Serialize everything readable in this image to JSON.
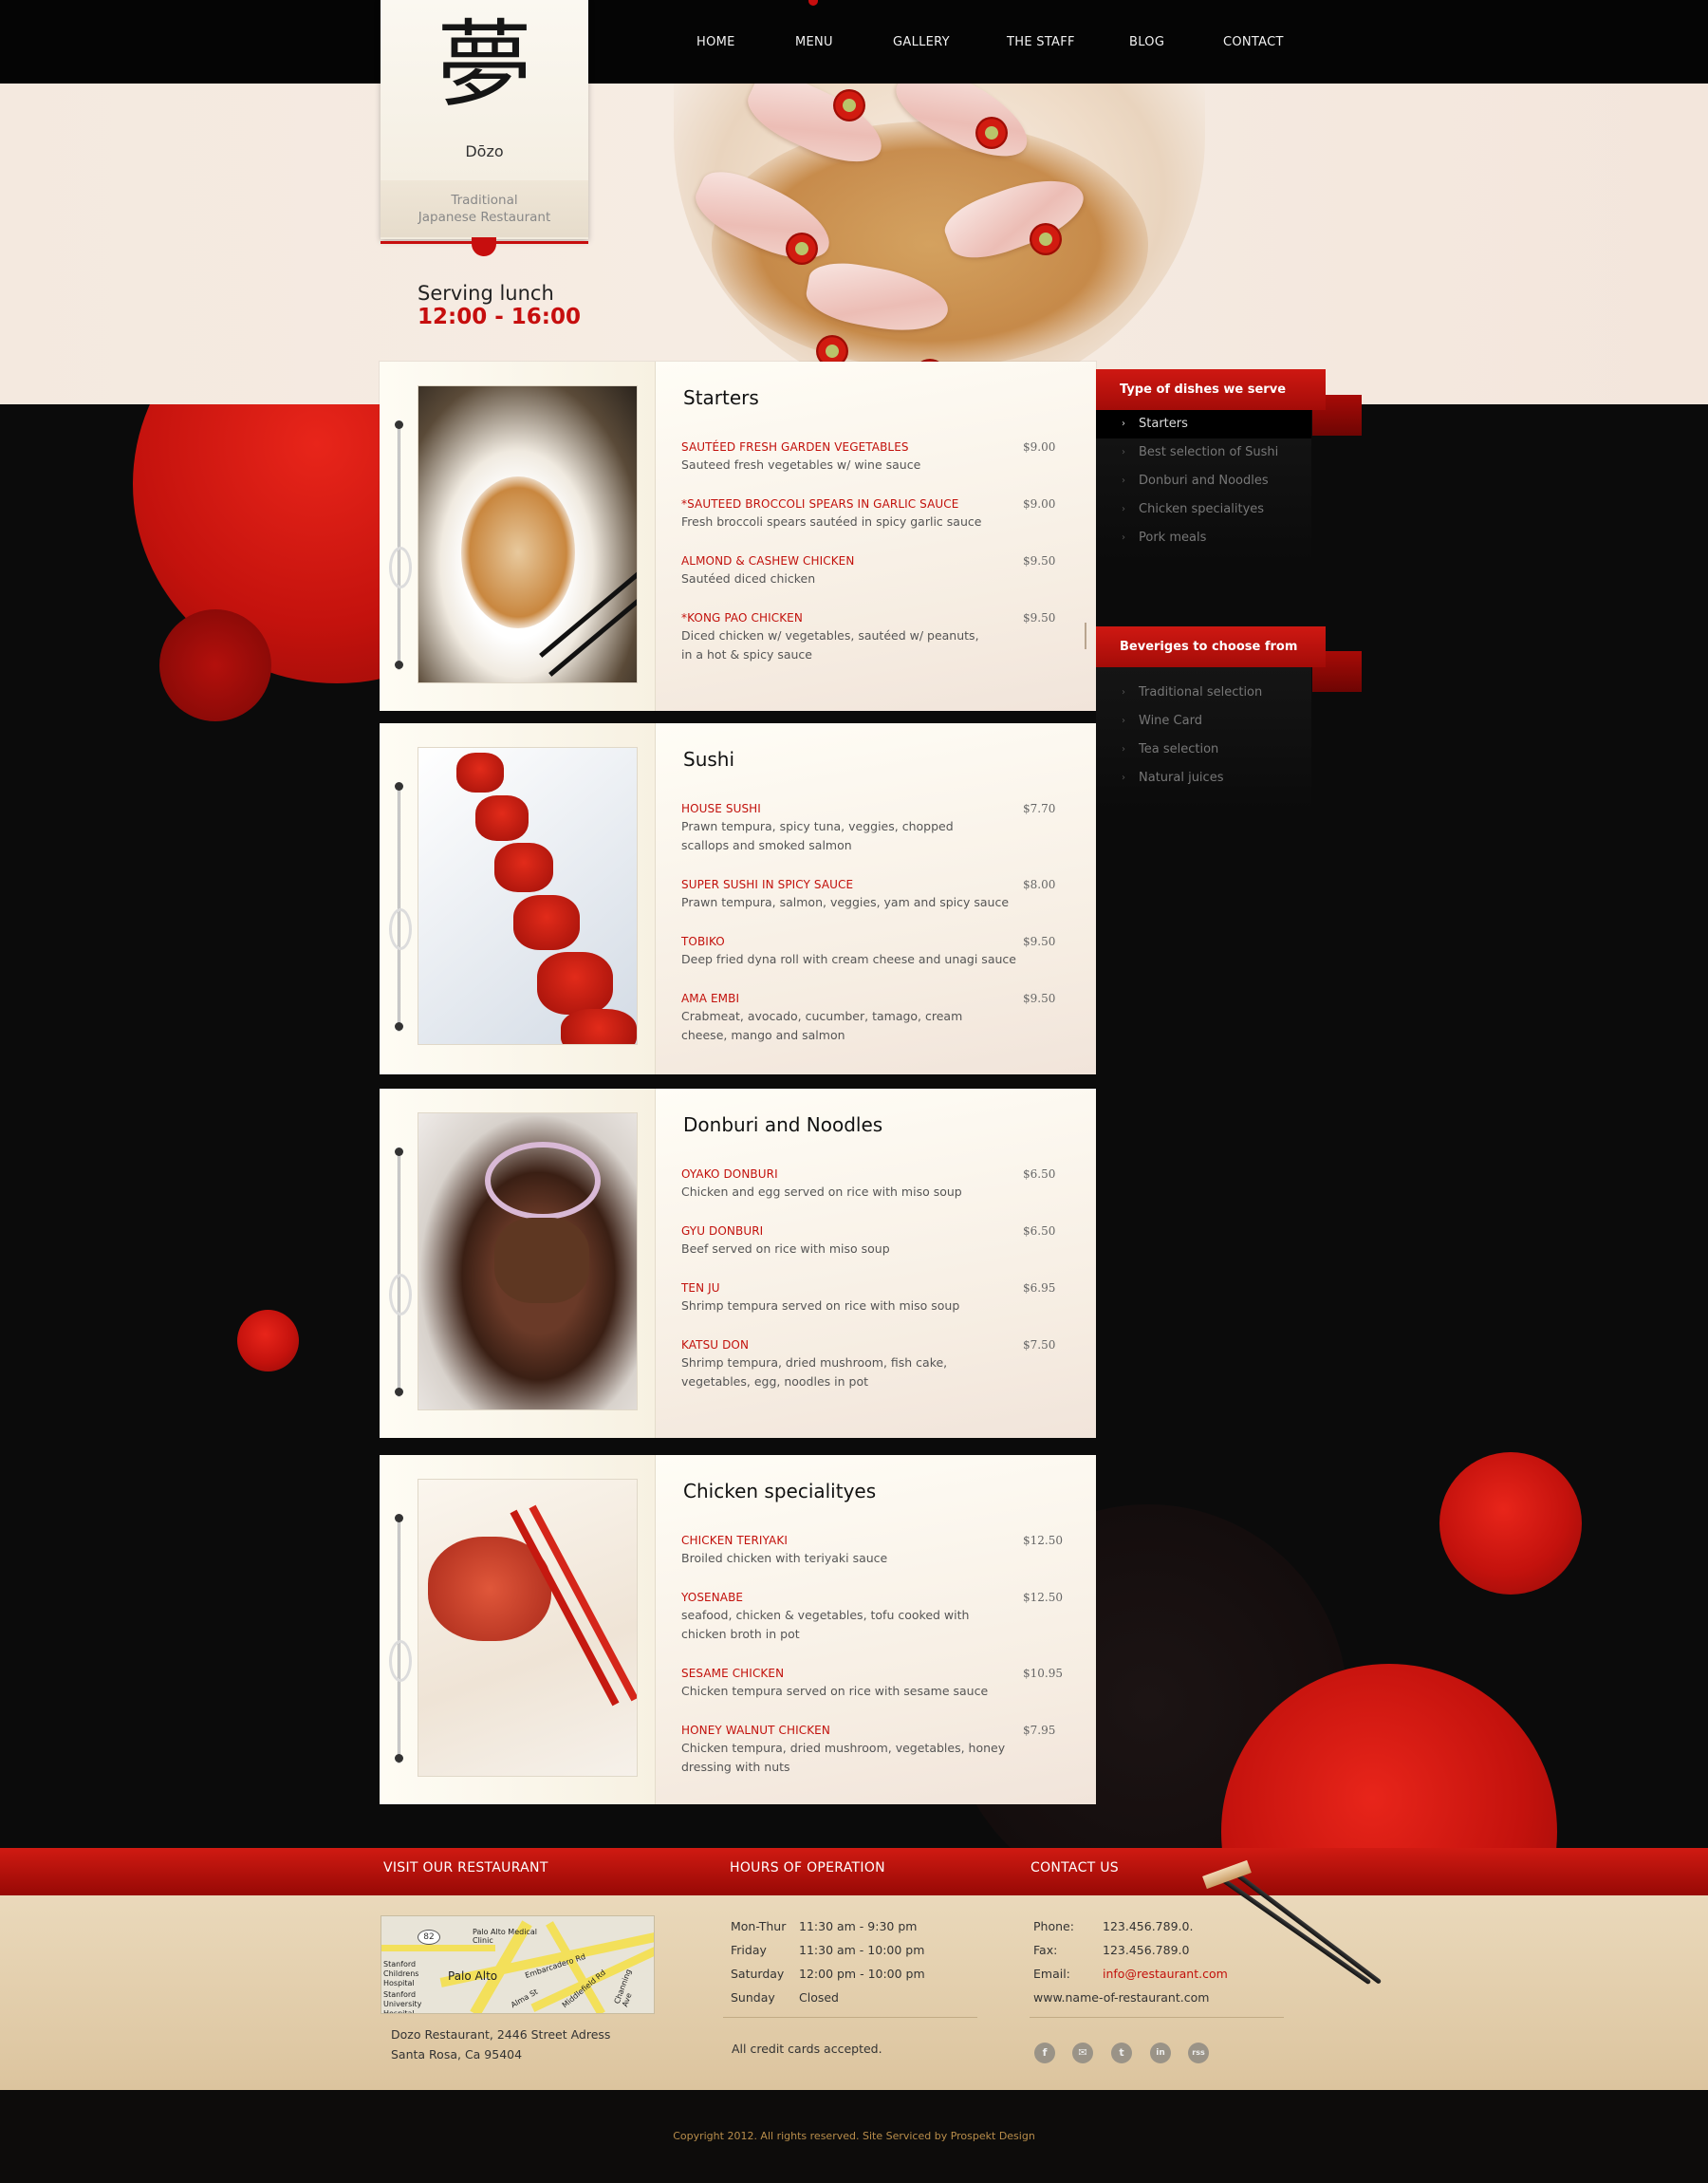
{
  "nav": {
    "items": [
      "HOME",
      "MENU",
      "GALLERY",
      "THE STAFF",
      "BLOG",
      "CONTACT"
    ]
  },
  "logo": {
    "kanji": "夢",
    "name": "Dōzo",
    "tagline_1": "Traditional",
    "tagline_2": "Japanese Restaurant"
  },
  "hours_banner": {
    "label": "Serving lunch",
    "time": "12:00 - 16:00"
  },
  "menu": [
    {
      "title": "Starters",
      "items": [
        {
          "name": "SAUTÉED FRESH GARDEN VEGETABLES",
          "desc": "Sauteed fresh vegetables w/ wine sauce",
          "price": "$9.00"
        },
        {
          "name": "*SAUTEED BROCCOLI SPEARS IN GARLIC SAUCE",
          "desc": "Fresh broccoli spears sautéed in spicy garlic sauce",
          "price": "$9.00"
        },
        {
          "name": "ALMOND & CASHEW CHICKEN",
          "desc": "Sautéed diced chicken",
          "price": "$9.50"
        },
        {
          "name": "*KONG PAO CHICKEN",
          "desc": "Diced chicken w/ vegetables, sautéed w/ peanuts, in a hot & spicy sauce",
          "price": "$9.50"
        }
      ]
    },
    {
      "title": "Sushi",
      "items": [
        {
          "name": "HOUSE SUSHI",
          "desc": "Prawn tempura, spicy tuna, veggies, chopped scallops and smoked salmon",
          "price": "$7.70"
        },
        {
          "name": "SUPER SUSHI  IN SPICY SAUCE",
          "desc": "Prawn tempura, salmon, veggies, yam and spicy sauce",
          "price": "$8.00"
        },
        {
          "name": "TOBIKO",
          "desc": "Deep fried dyna roll with cream cheese and unagi sauce",
          "price": "$9.50"
        },
        {
          "name": "AMA EMBI",
          "desc": "Crabmeat, avocado, cucumber, tamago, cream cheese, mango and salmon",
          "price": "$9.50"
        }
      ]
    },
    {
      "title": "Donburi and Noodles",
      "items": [
        {
          "name": "OYAKO DONBURI",
          "desc": "Chicken and egg served on rice with miso soup",
          "price": "$6.50"
        },
        {
          "name": "GYU DONBURI",
          "desc": "Beef served on rice with miso soup",
          "price": "$6.50"
        },
        {
          "name": "TEN JU",
          "desc": "Shrimp tempura served on rice with miso soup",
          "price": "$6.95"
        },
        {
          "name": "KATSU DON",
          "desc": "Shrimp tempura, dried mushroom, fish cake, vegetables, egg, noodles in pot",
          "price": "$7.50"
        }
      ]
    },
    {
      "title": "Chicken specialityes",
      "items": [
        {
          "name": "CHICKEN TERIYAKI",
          "desc": "Broiled chicken with teriyaki sauce",
          "price": "$12.50"
        },
        {
          "name": "YOSENABE",
          "desc": "seafood, chicken & vegetables, tofu cooked with chicken broth in pot",
          "price": "$12.50"
        },
        {
          "name": "SESAME CHICKEN",
          "desc": "Chicken tempura served on rice with sesame sauce",
          "price": "$10.95"
        },
        {
          "name": "HONEY WALNUT CHICKEN",
          "desc": "Chicken  tempura, dried mushroom, vegetables, honey dressing with nuts",
          "price": "$7.95"
        }
      ]
    }
  ],
  "sidebar": {
    "dishes_title": "Type of dishes we serve",
    "dishes": [
      "Starters",
      "Best selection of Sushi",
      "Donburi and Noodles",
      "Chicken specialityes",
      "Pork meals"
    ],
    "drinks_title": "Beveriges to choose from",
    "drinks": [
      "Traditional selection",
      "Wine Card",
      "Tea selection",
      "Natural juices"
    ]
  },
  "footer": {
    "visit_title": "VISIT OUR RESTAURANT",
    "hours_title": "HOURS OF OPERATION",
    "contact_title": "CONTACT US",
    "address_1": "Dozo Restaurant, 2446 Street Adress",
    "address_2": "Santa Rosa, Ca 95404",
    "map_labels": {
      "city": "Palo Alto",
      "clinic": "Palo Alto Medical Clinic",
      "hospital1": "Stanford Childrens Hospital",
      "hospital2": "Stanford University Hospital",
      "route": "82",
      "street1": "Embarcadero Rd",
      "street2": "Alma St",
      "street3": "Middlefield Rd",
      "street4": "Channing Ave"
    },
    "hours": [
      {
        "day": "Mon-Thur",
        "time": "11:30 am -  9:30 pm"
      },
      {
        "day": "Friday",
        "time": "11:30 am - 10:00 pm"
      },
      {
        "day": "Saturday",
        "time": "12:00 pm - 10:00 pm"
      },
      {
        "day": "Sunday",
        "time": "Closed"
      }
    ],
    "credit": "All credit cards accepted.",
    "contact": [
      {
        "label": "Phone:",
        "value": "123.456.789.0."
      },
      {
        "label": "Fax:",
        "value": "123.456.789.0"
      },
      {
        "label": "Email:",
        "value": "info@restaurant.com"
      }
    ],
    "website": "www.name-of-restaurant.com",
    "social": [
      "f",
      "✉",
      "t",
      "in",
      "rss"
    ],
    "copyright": "Copyright 2012. All rights reserved. Site Serviced by Prospekt Design"
  },
  "colors": {
    "accent": "#c60e0e",
    "dark": "#050505",
    "cream": "#fdfbf5",
    "footer_sand": "#e2cfac"
  }
}
